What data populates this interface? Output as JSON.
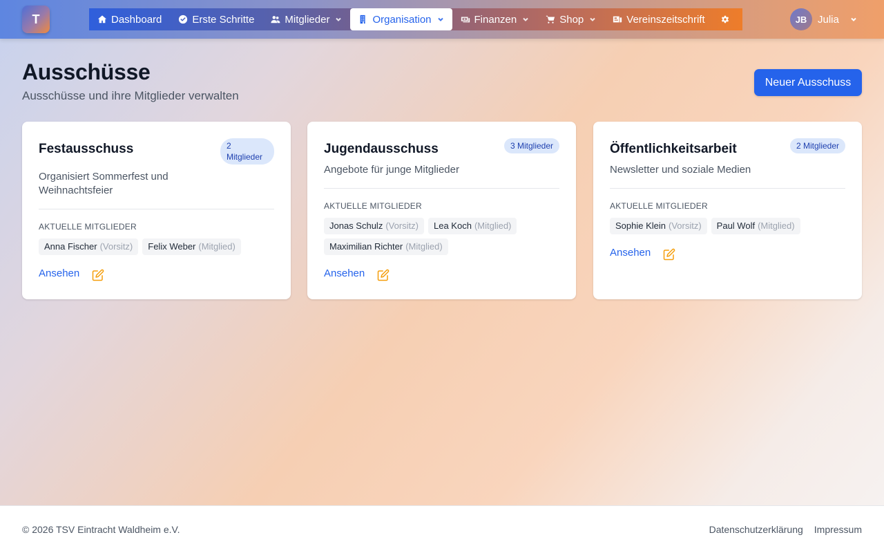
{
  "app": {
    "logo_letter": "T"
  },
  "nav": {
    "items": [
      {
        "label": "Dashboard",
        "icon": "home-icon",
        "has_dropdown": false
      },
      {
        "label": "Erste Schritte",
        "icon": "check-circle-icon",
        "has_dropdown": false
      },
      {
        "label": "Mitglieder",
        "icon": "users-icon",
        "has_dropdown": true
      },
      {
        "label": "Organisation",
        "icon": "building-icon",
        "has_dropdown": true,
        "active": true
      },
      {
        "label": "Finanzen",
        "icon": "money-icon",
        "has_dropdown": true
      },
      {
        "label": "Shop",
        "icon": "cart-icon",
        "has_dropdown": true
      },
      {
        "label": "Vereinszeitschrift",
        "icon": "newspaper-icon",
        "has_dropdown": false
      }
    ],
    "settings_icon": "gear-icon"
  },
  "user": {
    "initials": "JB",
    "name": "Julia"
  },
  "page": {
    "title": "Ausschüsse",
    "subtitle": "Ausschüsse und ihre Mitglieder verwalten",
    "new_button": "Neuer Ausschuss"
  },
  "committees": [
    {
      "name": "Festausschuss",
      "description": "Organisiert Sommerfest und Weihnachtsfeier",
      "badge": "2 Mitglieder",
      "members_heading": "Aktuelle Mitglieder",
      "members": [
        {
          "name": "Anna Fischer",
          "role": "(Vorsitz)"
        },
        {
          "name": "Felix Weber",
          "role": "(Mitglied)"
        }
      ],
      "view_label": "Ansehen"
    },
    {
      "name": "Jugendausschuss",
      "description": "Angebote für junge Mitglieder",
      "badge": "3 Mitglieder",
      "members_heading": "Aktuelle Mitglieder",
      "members": [
        {
          "name": "Jonas Schulz",
          "role": "(Vorsitz)"
        },
        {
          "name": "Lea Koch",
          "role": "(Mitglied)"
        },
        {
          "name": "Maximilian Richter",
          "role": "(Mitglied)"
        }
      ],
      "view_label": "Ansehen"
    },
    {
      "name": "Öffentlichkeitsarbeit",
      "description": "Newsletter und soziale Medien",
      "badge": "2 Mitglieder",
      "members_heading": "Aktuelle Mitglieder",
      "members": [
        {
          "name": "Sophie Klein",
          "role": "(Vorsitz)"
        },
        {
          "name": "Paul Wolf",
          "role": "(Mitglied)"
        }
      ],
      "view_label": "Ansehen"
    }
  ],
  "footer": {
    "copyright": "© 2026 TSV Eintracht Waldheim e.V.",
    "links": [
      "Datenschutzerklärung",
      "Impressum"
    ]
  },
  "colors": {
    "primary": "#2563eb",
    "edit_icon": "#f59e0b",
    "badge_bg": "#dbe7fb"
  }
}
